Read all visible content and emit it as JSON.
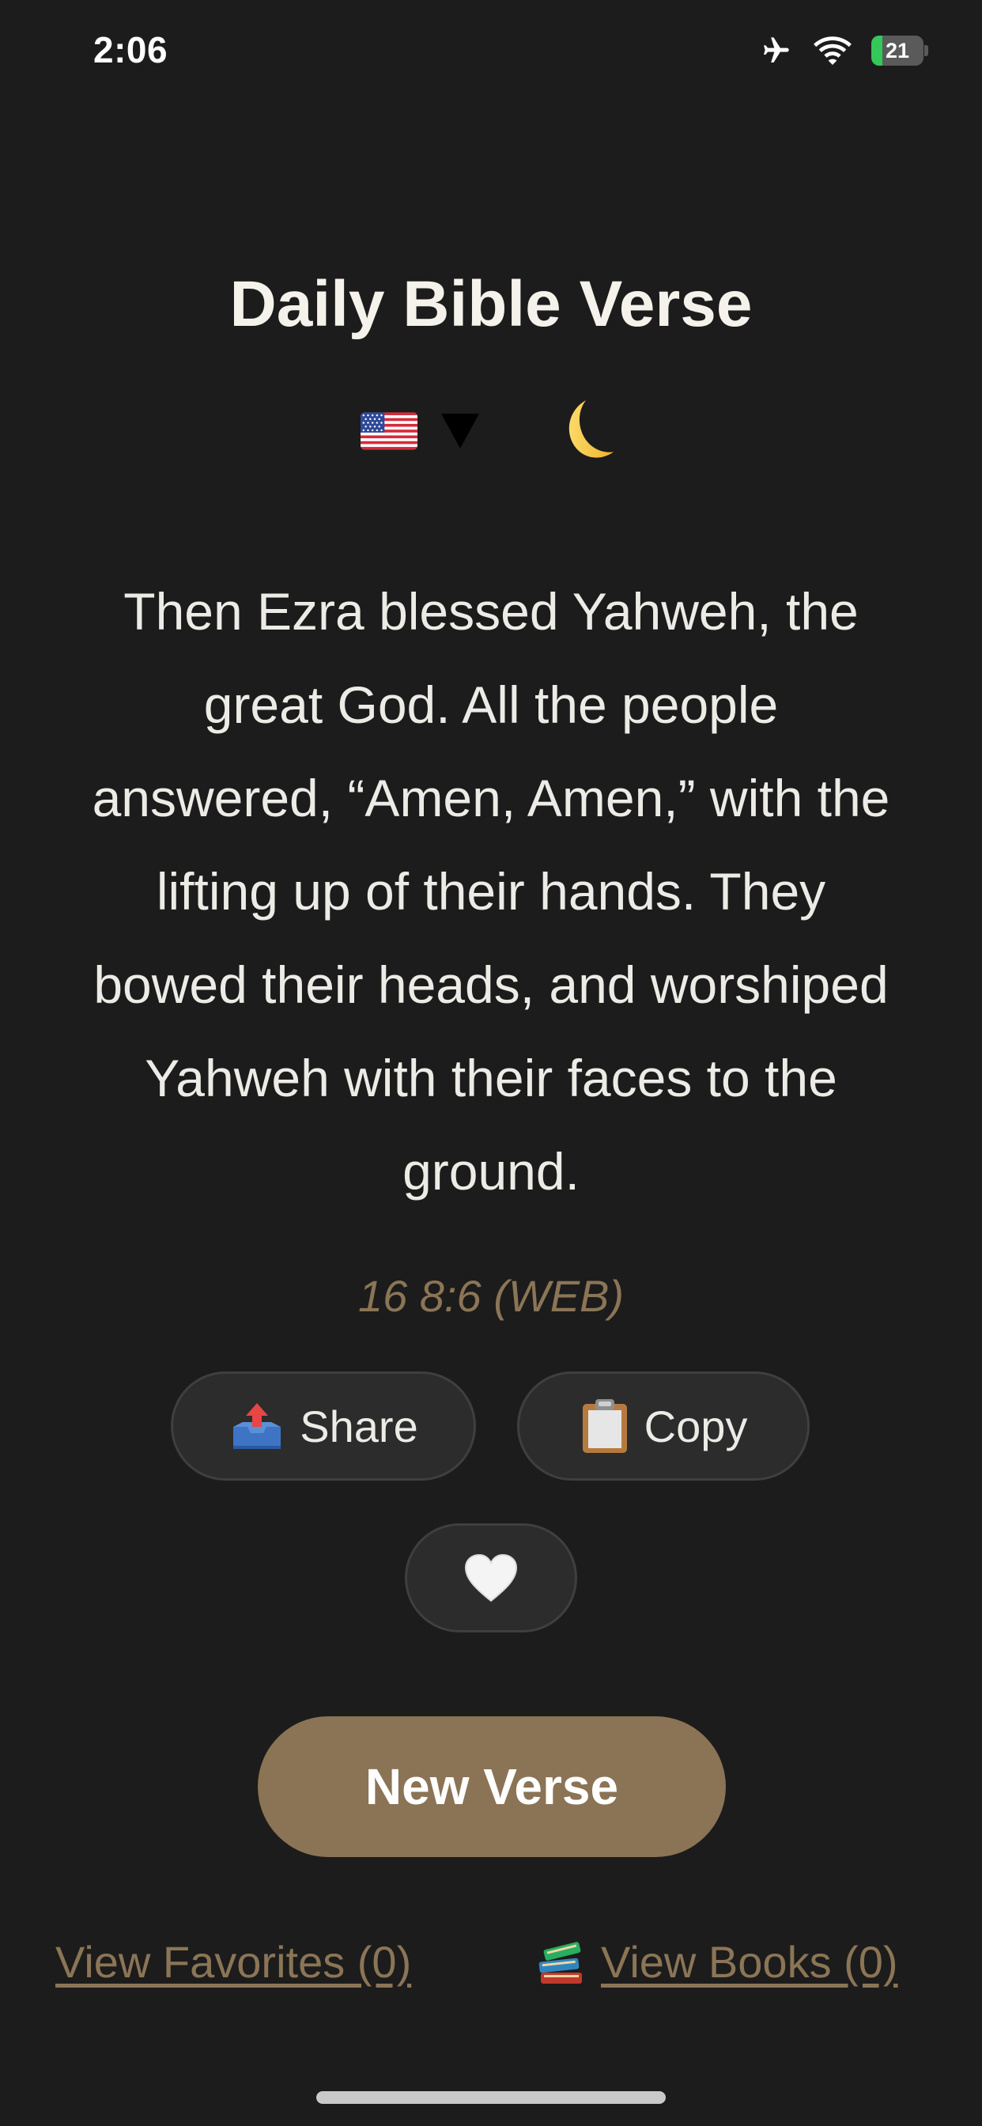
{
  "status_bar": {
    "time": "2:06",
    "battery_level": "21",
    "battery_fraction": 0.21,
    "airplane_mode": true,
    "wifi": true
  },
  "header": {
    "title": "Daily Bible Verse"
  },
  "controls": {
    "language_flag_icon": "us-flag-icon",
    "dropdown_icon": "dropdown-arrow-icon",
    "theme_icon": "crescent-moon-icon"
  },
  "verse": {
    "text": "Then Ezra blessed Yahweh, the great God. All the people answered, “Amen, Amen,” with the lifting up of their hands. They bowed their heads, and worshiped Yahweh with their faces to the ground.",
    "reference": "16 8:6 (WEB)"
  },
  "actions": {
    "share_icon": "outbox-tray-icon",
    "share_label": "Share",
    "copy_icon": "clipboard-icon",
    "copy_label": "Copy",
    "favorite_icon": "white-heart-icon"
  },
  "new_verse_label": "New Verse",
  "links": {
    "favorites_label": "View Favorites (0)",
    "books_icon": "books-icon",
    "books_label": "View Books (0)"
  },
  "colors": {
    "background": "#1c1c1c",
    "accent": "#8b7355",
    "reference_text": "#8b7556",
    "button_bg": "#2c2c2c"
  }
}
